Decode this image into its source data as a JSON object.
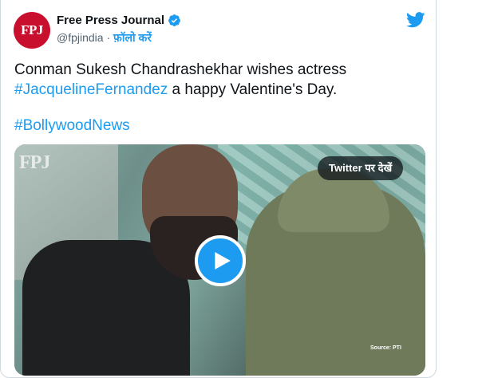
{
  "account": {
    "avatar_text": "FPJ",
    "name": "Free Press Journal",
    "handle": "@fpjindia",
    "separator": "·",
    "follow_label": "फ़ॉलो करें"
  },
  "tweet": {
    "line1": "Conman Sukesh Chandrashekhar wishes actress",
    "hashtag1": "#JacquelineFernandez",
    "line2_rest": " a happy Valentine's Day.",
    "hashtag2": "#BollywoodNews"
  },
  "media": {
    "watermark": "FPJ",
    "view_on_twitter": "Twitter पर देखें",
    "source": "Source: PTI",
    "play_icon": "play-icon"
  },
  "colors": {
    "accent": "#1d9bf0",
    "brand": "#c8102e",
    "text": "#0f1419",
    "muted": "#536471"
  },
  "icons": [
    "verified-badge-icon",
    "twitter-bird-icon",
    "play-icon"
  ]
}
